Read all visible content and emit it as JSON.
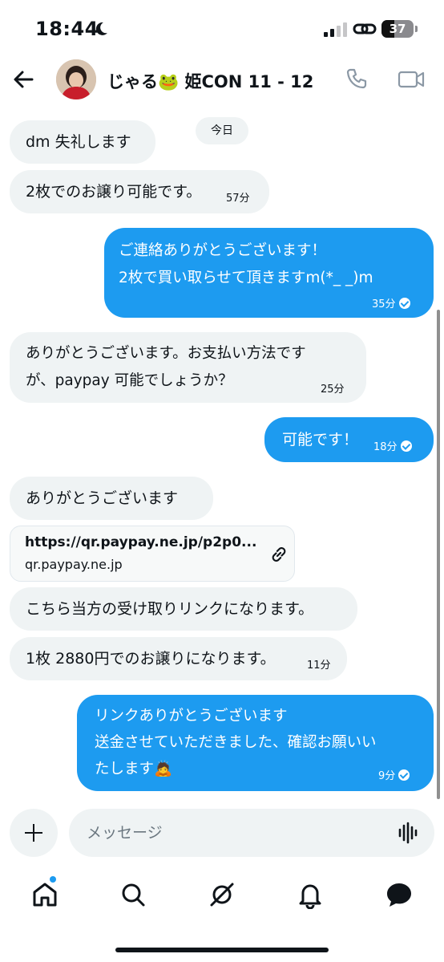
{
  "status_bar": {
    "time": "18:44",
    "battery": "37",
    "icons": [
      "moon-icon",
      "signal-icon",
      "link-icon",
      "battery-icon"
    ]
  },
  "header": {
    "contact_name": "じゃる🐸 姫CON 11 - 12",
    "icons": [
      "back-arrow-icon",
      "phone-icon",
      "video-icon"
    ]
  },
  "date_divider": "今日",
  "messages": [
    {
      "dir": "in",
      "text": "dm 失礼します",
      "time": ""
    },
    {
      "dir": "in",
      "text": "2枚でのお譲り可能です。",
      "time": "57分"
    },
    {
      "dir": "out",
      "lines": [
        "ご連絡ありがとうございます！",
        "2枚で買い取らせて頂きますm(*_ _)m"
      ],
      "time": "35分"
    },
    {
      "dir": "in",
      "lines": [
        "ありがとうございます。お支払い方法です",
        "が、paypay 可能でしょうか？"
      ],
      "time": "25分"
    },
    {
      "dir": "out",
      "text": "可能です！",
      "time": "18分"
    },
    {
      "dir": "in",
      "text": "ありがとうございます",
      "time": ""
    },
    {
      "dir": "in",
      "text": "こちら当方の受け取りリンクになります。",
      "time": ""
    },
    {
      "dir": "in",
      "text": "1枚 2880円でのお譲りになります。",
      "time": "11分"
    },
    {
      "dir": "out",
      "lines": [
        "リンクありがとうございます",
        "送金させていただきました、確認お願いい",
        "たします🙇"
      ],
      "time": "9分"
    }
  ],
  "link_card": {
    "url": "https://qr.paypay.ne.jp/p2p0...",
    "domain": "qr.paypay.ne.jp"
  },
  "composer": {
    "placeholder": "メッセージ"
  },
  "bottom_nav": [
    "home-icon",
    "search-icon",
    "grok-icon",
    "notifications-icon",
    "messages-icon"
  ],
  "colors": {
    "accent": "#1d9bf0",
    "bubble_in": "#eff3f4",
    "text": "#0f1419"
  }
}
